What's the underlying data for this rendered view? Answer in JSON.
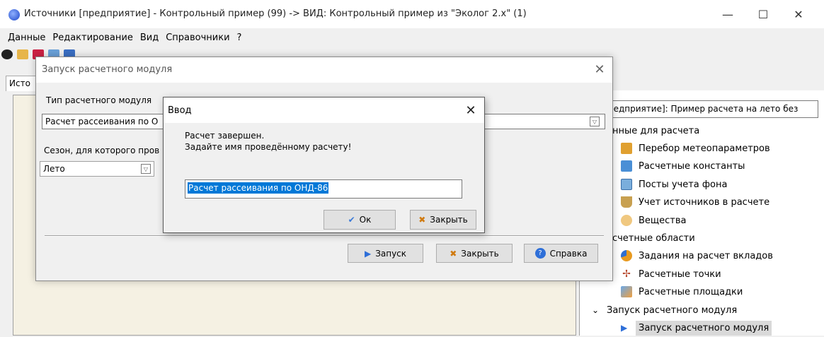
{
  "window": {
    "title": "Источники [предприятие] - Контрольный пример (99) -> ВИД: Контрольный пример из \"Эколог 2.х\" (1)",
    "controls": [
      "—",
      "☐",
      "✕"
    ]
  },
  "menu": [
    "Данные",
    "Редактирование",
    "Вид",
    "Справочники",
    "?"
  ],
  "tab_label": "Исто",
  "tree": {
    "header": "редприятие]: Пример расчета на лето без",
    "items": [
      {
        "label": "анные для расчета",
        "level": 0
      },
      {
        "label": "Перебор метеопараметров",
        "level": 1,
        "icon": "meteo-icon"
      },
      {
        "label": "Расчетные константы",
        "level": 1,
        "icon": "constants-icon"
      },
      {
        "label": "Посты учета фона",
        "level": 1,
        "icon": "background-posts-icon"
      },
      {
        "label": "Учет источников в расчете",
        "level": 1,
        "icon": "sources-filter-icon"
      },
      {
        "label": "Вещества",
        "level": 1,
        "icon": "substances-icon"
      },
      {
        "label": "асчетные области",
        "level": 0
      },
      {
        "label": "Задания на расчет вкладов",
        "level": 1,
        "icon": "pie-chart-icon"
      },
      {
        "label": "Расчетные точки",
        "level": 1,
        "icon": "points-icon"
      },
      {
        "label": "Расчетные площадки",
        "level": 1,
        "icon": "areas-icon"
      },
      {
        "label": "Запуск расчетного модуля",
        "level": 0,
        "expander": "⌄"
      },
      {
        "label": "Запуск расчетного модуля",
        "level": 1,
        "icon": "play-icon",
        "selected": true
      }
    ]
  },
  "launch_dialog": {
    "title": "Запуск расчетного модуля",
    "module_type_label": "Тип расчетного модуля",
    "module_type_value": "Расчет рассеивания по О",
    "season_label": "Сезон, для которого пров",
    "season_value": "Лето",
    "buttons": {
      "run": "Запуск",
      "close": "Закрыть",
      "help": "Справка"
    }
  },
  "input_dialog": {
    "title": "Ввод",
    "message_line1": "Расчет завершен.",
    "message_line2": "Задайте имя проведённому расчету!",
    "name_value": "Расчет рассеивания по ОНД-86",
    "buttons": {
      "ok": "Ок",
      "close": "Закрыть"
    }
  },
  "colors": {
    "selection": "#0078d7",
    "panel_bg": "#f5f1e3"
  }
}
